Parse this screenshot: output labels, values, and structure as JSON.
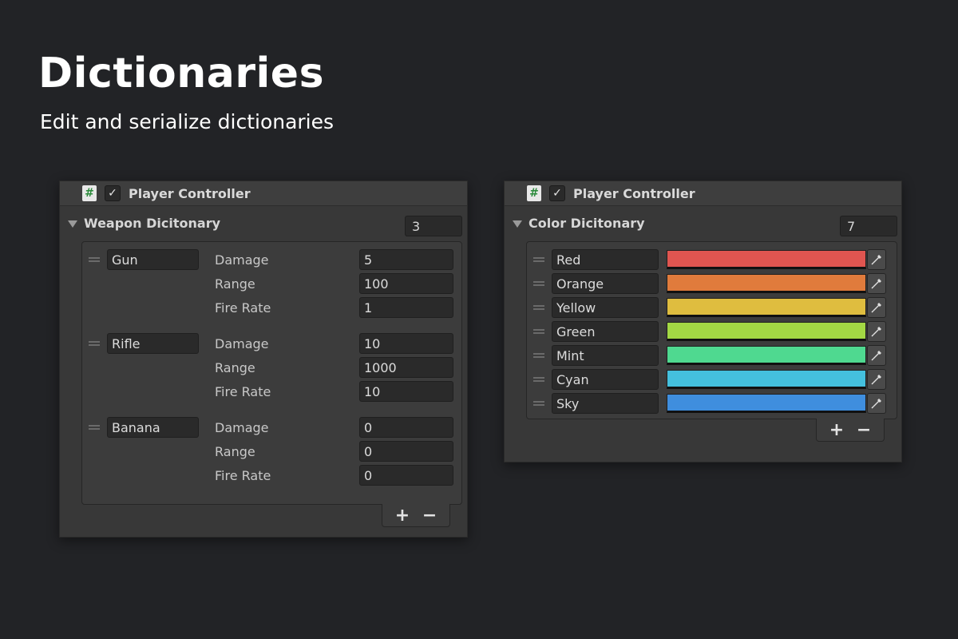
{
  "hero": {
    "title": "Dictionaries",
    "subtitle": "Edit and serialize dictionaries"
  },
  "weapons_panel": {
    "icon": "csharp-script-icon",
    "enabled": true,
    "title": "Player Controller",
    "dict_label": "Weapon Dicitonary",
    "size": "3",
    "entries": [
      {
        "key": "Gun",
        "fields": [
          {
            "label": "Damage",
            "value": "5"
          },
          {
            "label": "Range",
            "value": "100"
          },
          {
            "label": "Fire Rate",
            "value": "1"
          }
        ]
      },
      {
        "key": "Rifle",
        "fields": [
          {
            "label": "Damage",
            "value": "10"
          },
          {
            "label": "Range",
            "value": "1000"
          },
          {
            "label": "Fire Rate",
            "value": "10"
          }
        ]
      },
      {
        "key": "Banana",
        "fields": [
          {
            "label": "Damage",
            "value": "0"
          },
          {
            "label": "Range",
            "value": "0"
          },
          {
            "label": "Fire Rate",
            "value": "0"
          }
        ]
      }
    ],
    "add_label": "+",
    "remove_label": "−"
  },
  "colors_panel": {
    "icon": "csharp-script-icon",
    "enabled": true,
    "title": "Player Controller",
    "dict_label": "Color Dicitonary",
    "size": "7",
    "entries": [
      {
        "key": "Red",
        "color": "#e05550"
      },
      {
        "key": "Orange",
        "color": "#e07b3c"
      },
      {
        "key": "Yellow",
        "color": "#dfbd3f"
      },
      {
        "key": "Green",
        "color": "#a3d844"
      },
      {
        "key": "Mint",
        "color": "#4fd990"
      },
      {
        "key": "Cyan",
        "color": "#44c0de"
      },
      {
        "key": "Sky",
        "color": "#3f8ede"
      }
    ],
    "add_label": "+",
    "remove_label": "−"
  }
}
